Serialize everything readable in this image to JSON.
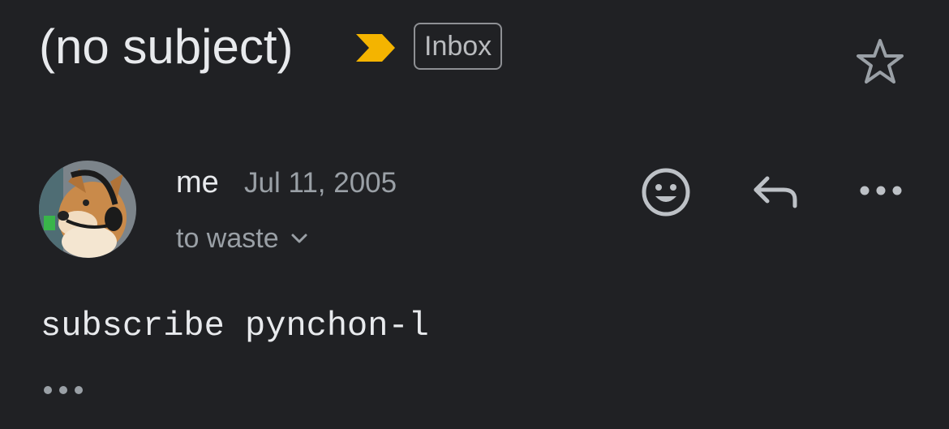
{
  "message": {
    "subject": "(no subject)",
    "label": "Inbox",
    "sender": "me",
    "date": "Jul 11, 2005",
    "recipients": "to waste",
    "body": "subscribe pynchon-l"
  },
  "icons": {
    "importance": "importance-marker-icon",
    "star": "star-outline-icon",
    "react": "emoji-smile-icon",
    "reply": "reply-arrow-icon",
    "more": "more-horizontal-icon",
    "recipients_expand": "chevron-down-icon",
    "trimmed_content": "ellipsis-icon"
  },
  "colors": {
    "background": "#202124",
    "importance": "#f4b400",
    "primary_text": "#e8eaed",
    "secondary_text": "#9aa0a6"
  }
}
